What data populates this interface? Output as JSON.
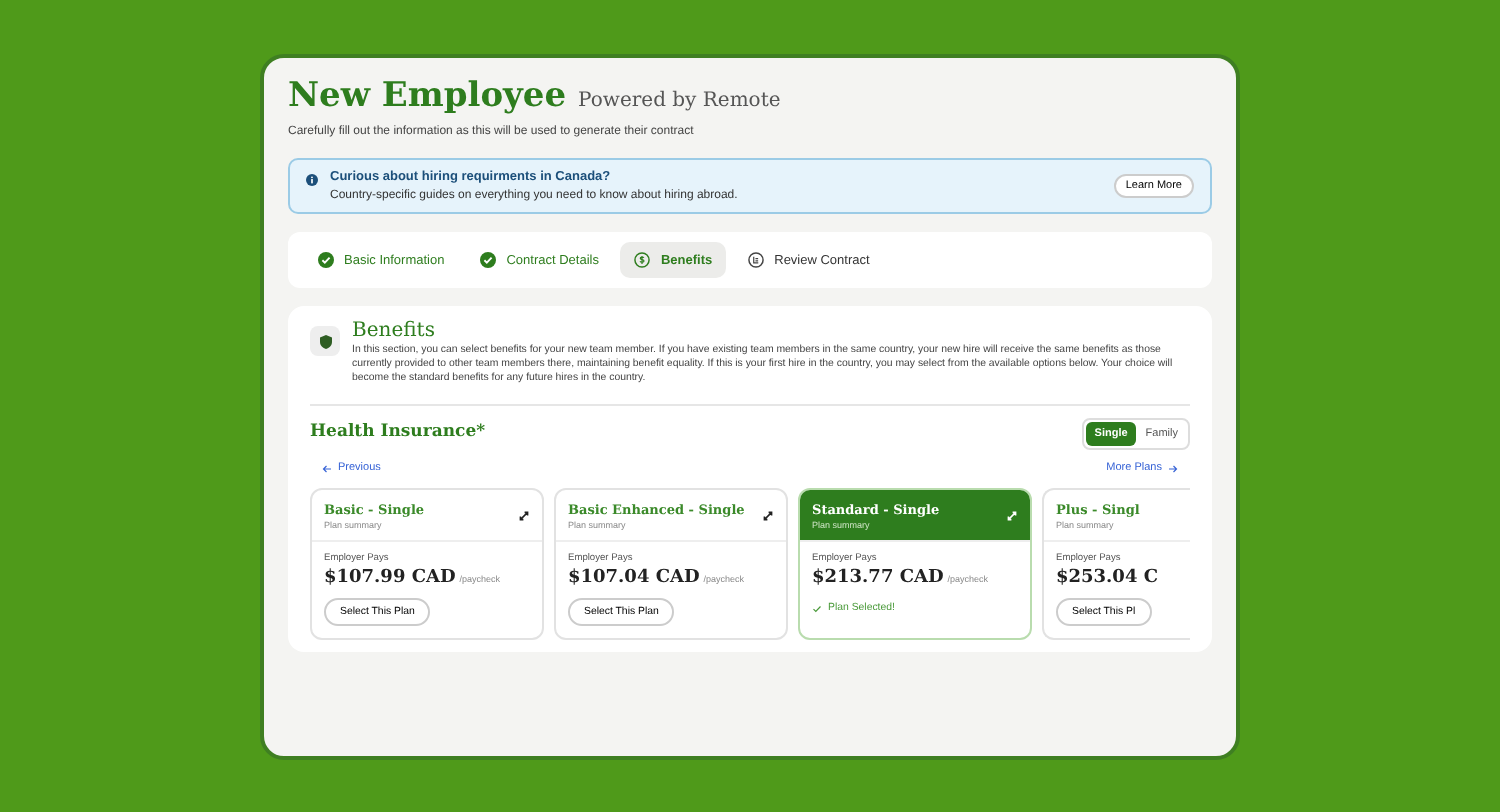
{
  "header": {
    "title": "New Employee",
    "powered_by": "Powered by Remote",
    "subtitle": "Carefully fill out the information as this will be used to generate their contract"
  },
  "banner": {
    "title": "Curious about hiring requirments in Canada?",
    "text": "Country-specific guides on everything you need to know about hiring abroad.",
    "button": "Learn More"
  },
  "steps": [
    {
      "label": "Basic Information",
      "completed": true,
      "selected": false
    },
    {
      "label": "Contract Details",
      "completed": true,
      "selected": false
    },
    {
      "label": "Benefits",
      "completed": false,
      "selected": true
    },
    {
      "label": "Review Contract",
      "completed": false,
      "selected": false
    }
  ],
  "benefits": {
    "title": "Benefits",
    "description": "In this section, you can select benefits for your new team member. If you have existing team members in the same country, your new hire will receive the same benefits as those currently provided to other team members there, maintaining benefit equality. If this is your first hire in the country, you may select from the available options below. Your choice will become the standard benefits for any future hires in the country."
  },
  "health_insurance": {
    "title": "Health Insurance*",
    "coverage": [
      {
        "label": "Single",
        "selected": true
      },
      {
        "label": "Family",
        "selected": false
      }
    ],
    "previous": "Previous",
    "more": "More Plans",
    "plans": [
      {
        "name": "Basic - Single",
        "summary": "Plan summary",
        "pays_label": "Employer Pays",
        "price": "$107.99 CAD",
        "period": "/paycheck",
        "action": "Select This Plan",
        "selected": false
      },
      {
        "name": "Basic Enhanced - Single",
        "summary": "Plan summary",
        "pays_label": "Employer Pays",
        "price": "$107.04 CAD",
        "period": "/paycheck",
        "action": "Select This Plan",
        "selected": false
      },
      {
        "name": "Standard - Single",
        "summary": "Plan summary",
        "pays_label": "Employer Pays",
        "price": "$213.77 CAD",
        "period": "/paycheck",
        "action": "Plan Selected!",
        "selected": true
      },
      {
        "name": "Plus - Singl",
        "summary": "Plan summary",
        "pays_label": "Employer Pays",
        "price": "$253.04 C",
        "action": "Select This Pl",
        "selected": false
      }
    ]
  }
}
